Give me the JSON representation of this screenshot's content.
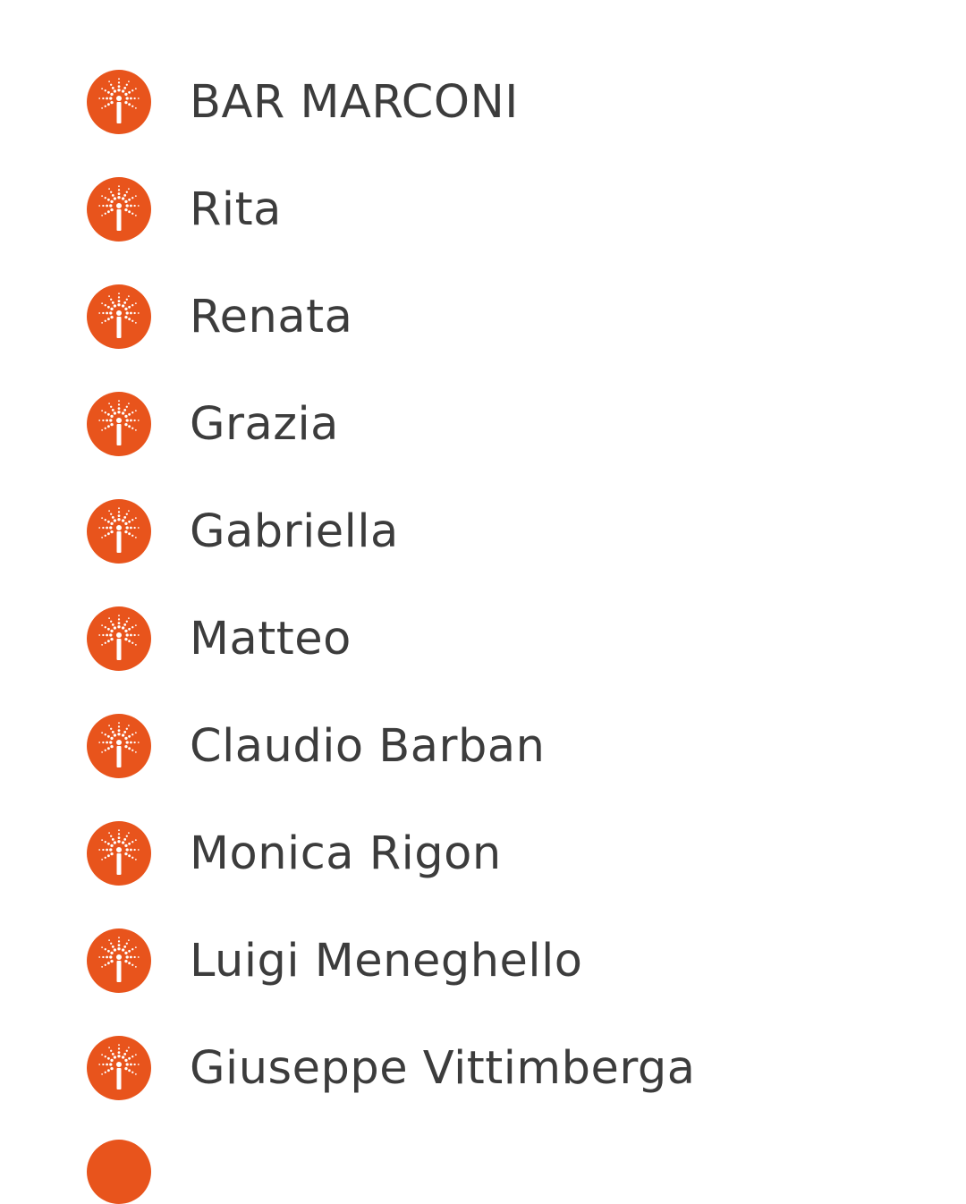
{
  "contacts": [
    {
      "name": "BAR MARCONI",
      "avatar_icon": "palm-tree-icon"
    },
    {
      "name": "Rita",
      "avatar_icon": "palm-tree-icon"
    },
    {
      "name": "Renata",
      "avatar_icon": "palm-tree-icon"
    },
    {
      "name": "Grazia",
      "avatar_icon": "palm-tree-icon"
    },
    {
      "name": "Gabriella",
      "avatar_icon": "palm-tree-icon"
    },
    {
      "name": "Matteo",
      "avatar_icon": "palm-tree-icon"
    },
    {
      "name": "Claudio Barban",
      "avatar_icon": "palm-tree-icon"
    },
    {
      "name": "Monica Rigon",
      "avatar_icon": "palm-tree-icon"
    },
    {
      "name": "Luigi Meneghello",
      "avatar_icon": "palm-tree-icon"
    },
    {
      "name": "Giuseppe Vittimberga",
      "avatar_icon": "palm-tree-icon"
    }
  ],
  "colors": {
    "avatar": "#e8541c",
    "avatar_glyph": "#ffffff",
    "name_text": "#3c3c3c",
    "background": "#ffffff"
  }
}
